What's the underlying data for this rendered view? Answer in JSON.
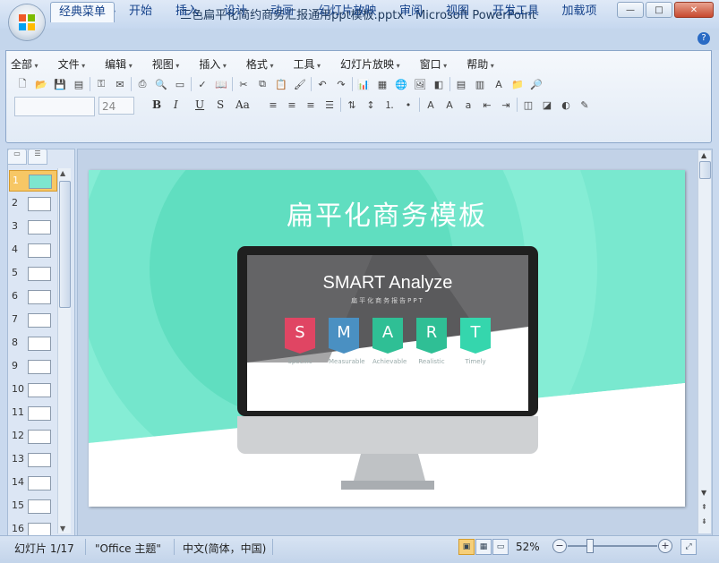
{
  "window": {
    "title": "三色扁平化简约商务汇报通用ppt模板.pptx - Microsoft PowerPoint",
    "minimize": "—",
    "maximize": "□",
    "close": "✕"
  },
  "ribbon_tabs": [
    "经典菜单",
    "开始",
    "插入",
    "设计",
    "动画",
    "幻灯片放映",
    "审阅",
    "视图",
    "开发工具",
    "加载项"
  ],
  "menu": [
    "全部",
    "文件",
    "编辑",
    "视图",
    "插入",
    "格式",
    "工具",
    "幻灯片放映",
    "窗口",
    "帮助"
  ],
  "font": {
    "name": "",
    "size": "24"
  },
  "format_buttons": [
    "B",
    "I",
    "U",
    "S",
    "Aa"
  ],
  "thumbnails": [
    "1",
    "2",
    "3",
    "4",
    "5",
    "6",
    "7",
    "8",
    "9",
    "10",
    "11",
    "12",
    "13",
    "14",
    "15",
    "16"
  ],
  "slide": {
    "title": "扁平化商务模板",
    "heading": "SMART Analyze",
    "subheading": "扁平化商务报告PPT",
    "letters": [
      {
        "letter": "S",
        "label": "Specific",
        "color": "#e04563"
      },
      {
        "letter": "M",
        "label": "Measurable",
        "color": "#4a90c2"
      },
      {
        "letter": "A",
        "label": "Achievable",
        "color": "#2fbf95"
      },
      {
        "letter": "R",
        "label": "Realistic",
        "color": "#2fbf95"
      },
      {
        "letter": "T",
        "label": "Timely",
        "color": "#35d6ad"
      }
    ],
    "colors": {
      "bg": "#79e8cf",
      "accent": "#3ad7b0"
    }
  },
  "status": {
    "slide": "幻灯片 1/17",
    "theme": "\"Office 主题\"",
    "language": "中文(简体，中国)",
    "zoom": "52%",
    "zoom_level": 0.52
  }
}
